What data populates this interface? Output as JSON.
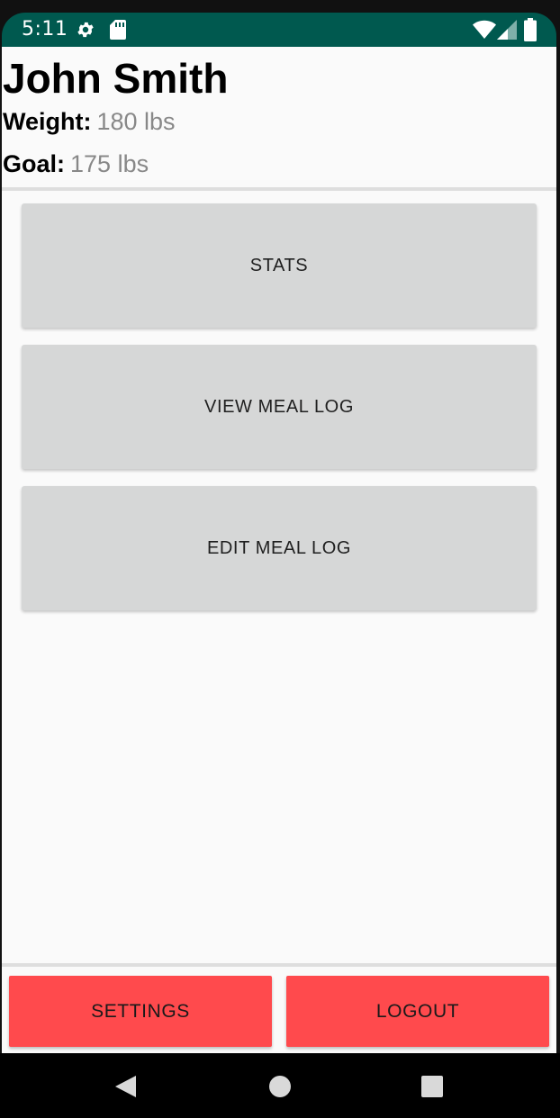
{
  "status_bar": {
    "time": "5:11",
    "color": "#00594f",
    "icons": [
      "settings-gear-icon",
      "sd-card-icon",
      "wifi-icon",
      "cellular-signal-icon",
      "battery-icon"
    ]
  },
  "profile": {
    "name": "John Smith",
    "weight_label": "Weight:",
    "weight_value": "180 lbs",
    "goal_label": "Goal:",
    "goal_value": "175 lbs"
  },
  "menu": {
    "stats_label": "STATS",
    "view_meal_log_label": "VIEW MEAL LOG",
    "edit_meal_log_label": "EDIT MEAL LOG",
    "button_color": "#d6d7d7"
  },
  "footer": {
    "settings_label": "SETTINGS",
    "logout_label": "LOGOUT",
    "button_color": "#ff4a4d"
  },
  "nav_bar": {
    "icons": [
      "back-triangle-icon",
      "home-circle-icon",
      "recents-square-icon"
    ]
  }
}
